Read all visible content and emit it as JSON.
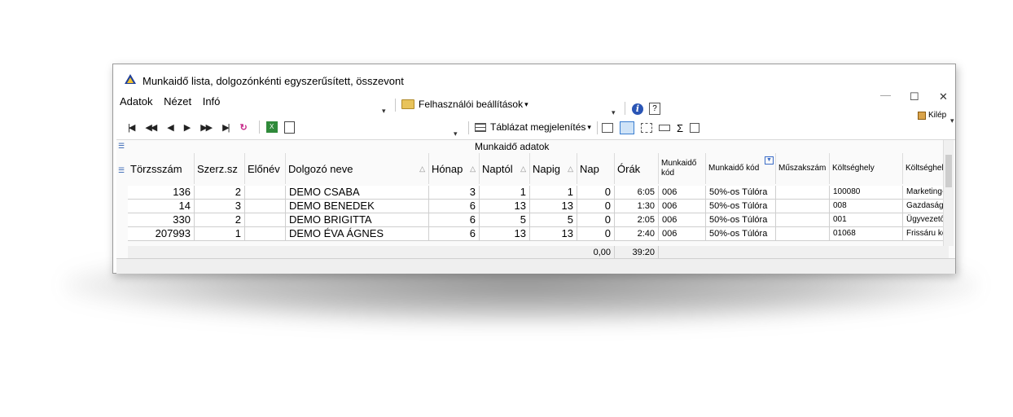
{
  "window": {
    "title": "Munkaidő lista, dolgozónkénti egyszerűsített, összevont",
    "minimize_glyph": "—",
    "maximize_glyph": "☐",
    "close_glyph": "✕"
  },
  "menu": {
    "items": [
      "Adatok",
      "Nézet",
      "Infó"
    ]
  },
  "toolbar": {
    "user_settings_label": "Felhasználói beállítások",
    "table_display_label": "Táblázat megjelenítés",
    "exit_label": "Kilép",
    "dropdown_glyph": "▾",
    "info_glyph": "i",
    "help_glyph": "?",
    "sigma_glyph": "Σ",
    "xls_glyph": "X"
  },
  "nav": {
    "first": "|◀",
    "prev_page": "◀◀",
    "prev": "◀",
    "next": "▶",
    "next_page": "▶▶",
    "last": "▶|",
    "refresh": "↻"
  },
  "grid": {
    "group_header": "Munkaidő adatok",
    "sort_glyph": "△",
    "columns": {
      "torzsszam": "Törzsszám",
      "szerz": "Szerz.sz",
      "elonev": "Előnév",
      "nev": "Dolgozó neve",
      "honap": "Hónap",
      "naptol": "Naptól",
      "napig": "Napig",
      "nap": "Nap",
      "orak": "Órák",
      "mkod": "Munkaidő kód",
      "mkod2": "Munkaidő kód",
      "muszak": "Műszakszám",
      "koltseg": "Költséghely",
      "koltseg2": "Költséghely"
    },
    "rows": [
      {
        "torzsszam": "136",
        "szerz": "2",
        "elonev": "",
        "nev": "DEMO CSABA",
        "honap": "3",
        "naptol": "1",
        "napig": "1",
        "nap": "0",
        "orak": "6:05",
        "mkod": "006",
        "mkod2": "50%-os Túlóra",
        "muszak": "",
        "koltseg": "100080",
        "koltseg2": "Marketing-B"
      },
      {
        "torzsszam": "14",
        "szerz": "3",
        "elonev": "",
        "nev": "DEMO BENEDEK",
        "honap": "6",
        "naptol": "13",
        "napig": "13",
        "nap": "0",
        "orak": "1:30",
        "mkod": "006",
        "mkod2": "50%-os Túlóra",
        "muszak": "",
        "koltseg": "008",
        "koltseg2": "Gazdasági v"
      },
      {
        "torzsszam": "330",
        "szerz": "2",
        "elonev": "",
        "nev": "DEMO BRIGITTA",
        "honap": "6",
        "naptol": "5",
        "napig": "5",
        "nap": "0",
        "orak": "2:05",
        "mkod": "006",
        "mkod2": "50%-os Túlóra",
        "muszak": "",
        "koltseg": "001",
        "koltseg2": "Ügyvezetős"
      },
      {
        "torzsszam": "207993",
        "szerz": "1",
        "elonev": "",
        "nev": "DEMO ÉVA ÁGNES",
        "honap": "6",
        "naptol": "13",
        "napig": "13",
        "nap": "0",
        "orak": "2:40",
        "mkod": "006",
        "mkod2": "50%-os Túlóra",
        "muszak": "",
        "koltseg": "01068",
        "koltseg2": "Frissáru köl"
      }
    ],
    "footer": {
      "nap_total": "0,00",
      "orak_total": "39:20"
    }
  }
}
